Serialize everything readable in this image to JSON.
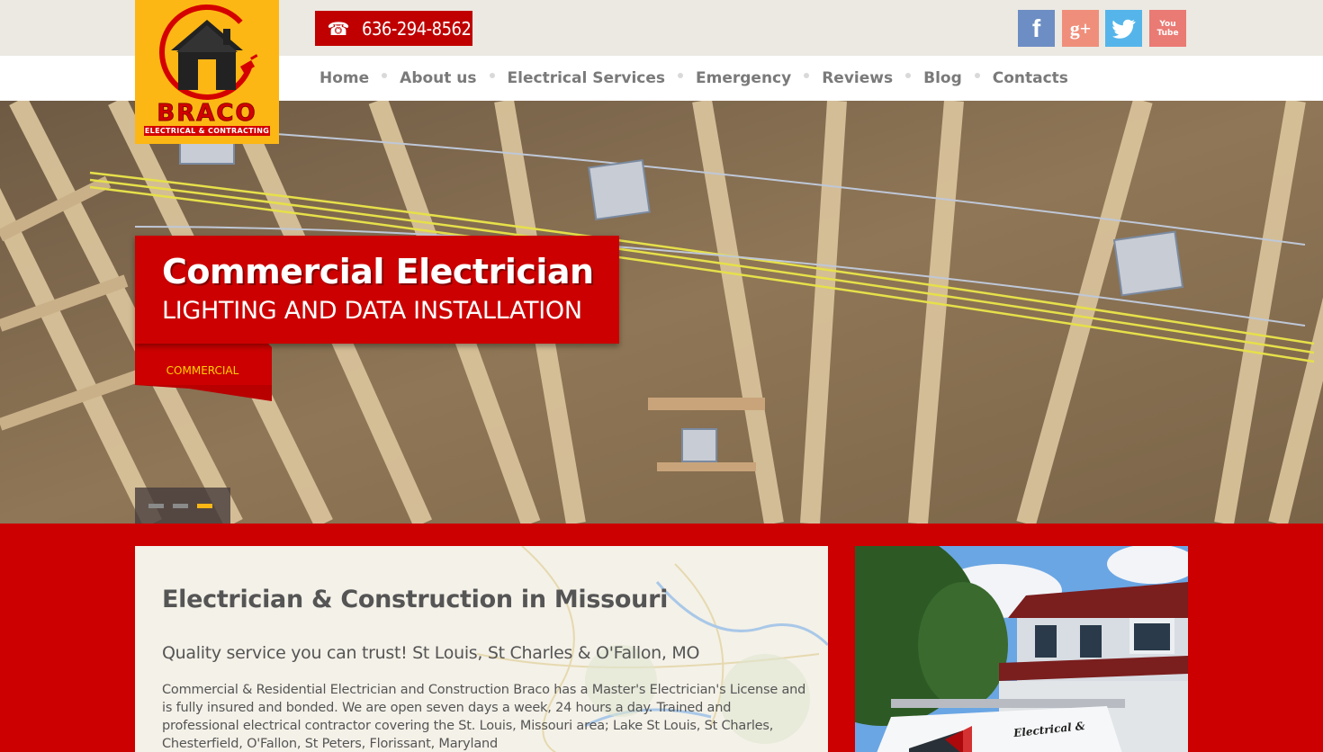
{
  "brand": {
    "name": "BRACO",
    "tagline": "ELECTRICAL & CONTRACTING",
    "colors": {
      "primary": "#cc0000",
      "accent": "#fdb714",
      "topbar": "#ebe9e2"
    }
  },
  "header": {
    "phone_icon": "☎",
    "phone": "636-294-8562",
    "social": [
      {
        "icon": "facebook-icon",
        "glyph": "f"
      },
      {
        "icon": "google-plus-icon",
        "glyph": "g+"
      },
      {
        "icon": "twitter-icon",
        "glyph": ""
      },
      {
        "icon": "youtube-icon",
        "glyph": "You\nTube"
      }
    ]
  },
  "nav": {
    "items": [
      "Home",
      "About us",
      "Electrical Services",
      "Emergency",
      "Reviews",
      "Blog",
      "Contacts"
    ]
  },
  "hero": {
    "title": "Commercial Electrician",
    "subtitle": "LIGHTING AND DATA INSTALLATION",
    "tag": "COMMERCIAL",
    "slides": 3,
    "active_slide": 3
  },
  "intro": {
    "title": "Electrician & Construction in Missouri",
    "subtitle": "Quality service you can trust! St Louis, St Charles & O'Fallon, MO",
    "body": "Commercial & Residential Electrician and Construction Braco has a Master's Electrician's License and is fully insured and bonded. We are open seven days a week, 24 hours a day. Trained and professional electrical contractor covering the St. Louis, Missouri area; Lake St Louis, St Charles, Chesterfield, O'Fallon, St Peters, Florissant, Maryland"
  },
  "photo": {
    "van_text": "Electrical &"
  }
}
